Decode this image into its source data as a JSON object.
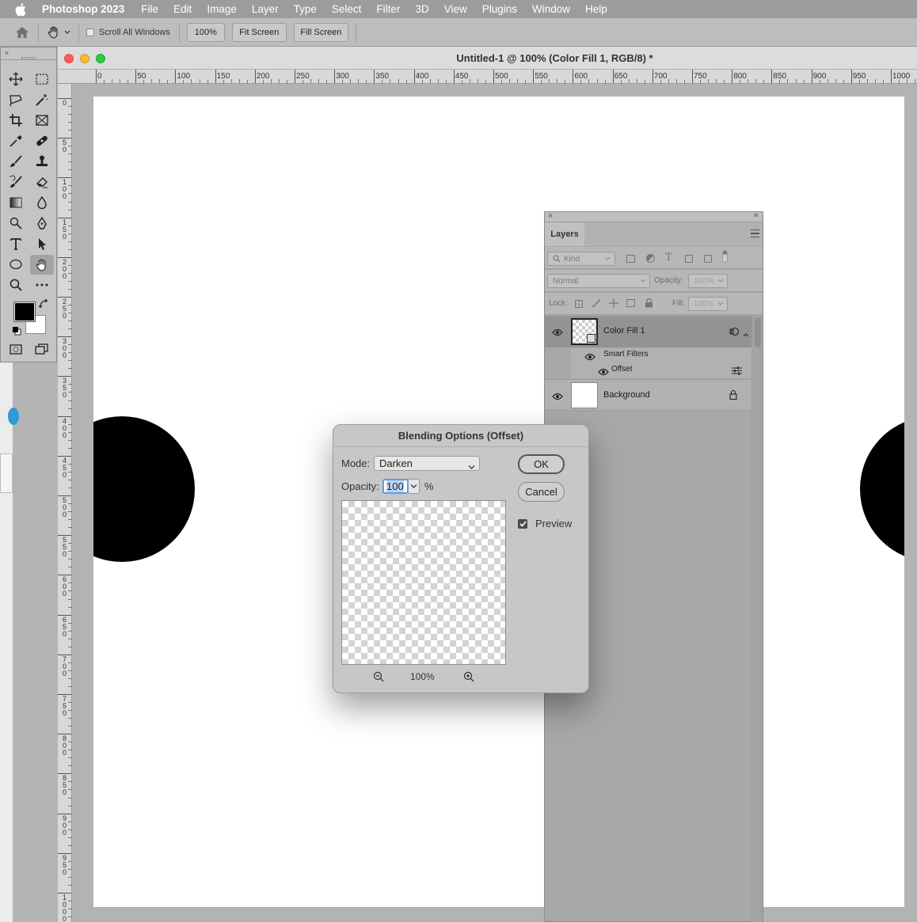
{
  "menubar": {
    "app_name": "Photoshop 2023",
    "items": [
      "File",
      "Edit",
      "Image",
      "Layer",
      "Type",
      "Select",
      "Filter",
      "3D",
      "View",
      "Plugins",
      "Window",
      "Help"
    ]
  },
  "options_bar": {
    "scroll_all_windows_label": "Scroll All Windows",
    "zoom_100_label": "100%",
    "fit_screen_label": "Fit Screen",
    "fill_screen_label": "Fill Screen"
  },
  "document": {
    "title": "Untitled-1 @ 100% (Color Fill 1, RGB/8) *",
    "h_ruler_labels": [
      "0",
      "50",
      "100",
      "150",
      "200",
      "250",
      "300",
      "350",
      "400",
      "450",
      "500",
      "550",
      "600",
      "650",
      "700",
      "750",
      "800",
      "850",
      "900",
      "950",
      "1000"
    ],
    "v_ruler_labels": [
      "0",
      "50",
      "100",
      "150",
      "200",
      "250",
      "300",
      "350",
      "400",
      "450",
      "500",
      "550",
      "600",
      "650",
      "700",
      "750",
      "800",
      "850",
      "900",
      "950",
      "1000"
    ]
  },
  "layers_panel": {
    "tab_label": "Layers",
    "filter_kind_label": "Kind",
    "blend_mode_label": "Normal",
    "opacity_label": "Opacity:",
    "opacity_value": "100%",
    "lock_label": "Lock:",
    "fill_label": "Fill:",
    "fill_value": "100%",
    "layers": {
      "color_fill": "Color Fill 1",
      "smart_filters": "Smart Filters",
      "offset": "Offset",
      "background": "Background"
    }
  },
  "dialog": {
    "title": "Blending Options (Offset)",
    "mode_label": "Mode:",
    "mode_value": "Darken",
    "opacity_label": "Opacity:",
    "opacity_value": "100",
    "percent_symbol": "%",
    "ok_label": "OK",
    "cancel_label": "Cancel",
    "preview_label": "Preview",
    "preview_checked": true,
    "zoom_value": "100%"
  },
  "colors": {
    "foreground": "#000000",
    "background": "#ffffff",
    "accent": "#5d9de7"
  }
}
